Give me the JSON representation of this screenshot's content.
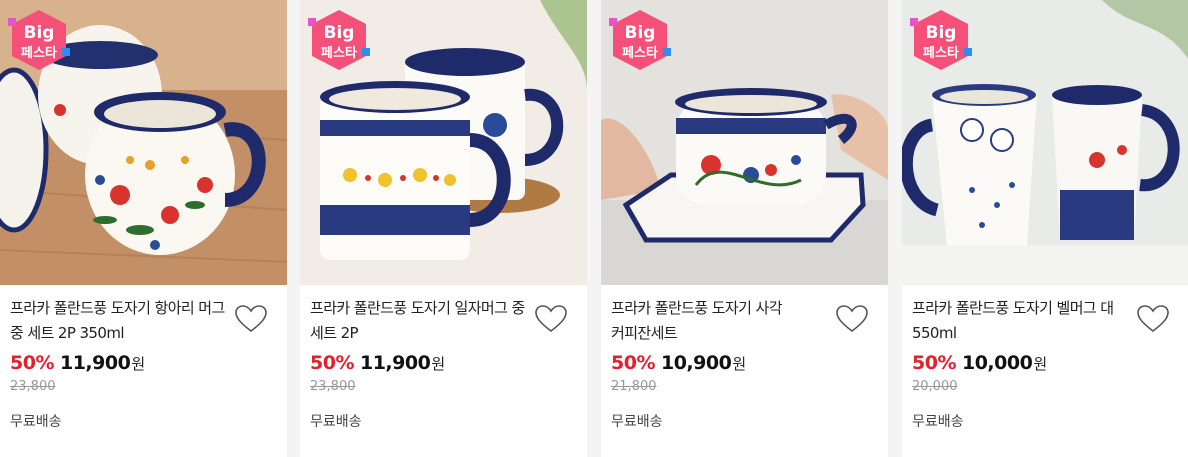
{
  "products": [
    {
      "badge_line1": "Big",
      "badge_line2": "페스타",
      "title": "프라카 폴란드풍 도자기 항아리 머그 중 세트 2P 350ml",
      "discount": "50%",
      "price": "11,900",
      "currency": "원",
      "original_price": "23,800",
      "shipping": "무료배송"
    },
    {
      "badge_line1": "Big",
      "badge_line2": "페스타",
      "title": "프라카 폴란드풍 도자기 일자머그 중 세트 2P",
      "discount": "50%",
      "price": "11,900",
      "currency": "원",
      "original_price": "23,800",
      "shipping": "무료배송"
    },
    {
      "badge_line1": "Big",
      "badge_line2": "페스타",
      "title": "프라카 폴란드풍 도자기 사각 커피잔세트",
      "discount": "50%",
      "price": "10,900",
      "currency": "원",
      "original_price": "21,800",
      "shipping": "무료배송"
    },
    {
      "badge_line1": "Big",
      "badge_line2": "페스타",
      "title": "프라카 폴란드풍 도자기 벨머그 대 550ml",
      "discount": "50%",
      "price": "10,000",
      "currency": "원",
      "original_price": "20,000",
      "shipping": "무료배송"
    }
  ],
  "colors": {
    "discount": "#e3202d",
    "badge": "#f4507a",
    "wishlist": "#555555"
  }
}
